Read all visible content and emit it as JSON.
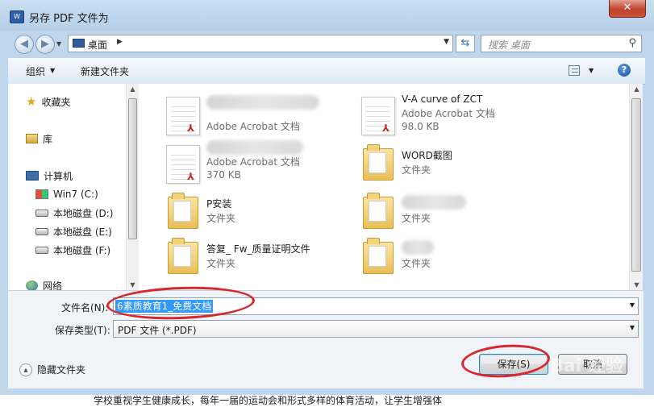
{
  "window": {
    "title": "另存 PDF 文件为",
    "app_icon": "W",
    "close": "✕"
  },
  "address": {
    "location": "桌面",
    "search_placeholder": "搜索 桌面"
  },
  "toolbar": {
    "organize": "组织",
    "new_folder": "新建文件夹"
  },
  "nav": {
    "favorites": "收藏夹",
    "libraries": "库",
    "computer": "计算机",
    "drives": [
      "Win7 (C:)",
      "本地磁盘 (D:)",
      "本地磁盘 (E:)",
      "本地磁盘 (F:)"
    ],
    "network": "网络"
  },
  "files": [
    {
      "name": "",
      "type": "Adobe Acrobat 文档",
      "size": "",
      "kind": "pdf"
    },
    {
      "name": "V-A curve of ZCT",
      "type": "Adobe Acrobat 文档",
      "size": "98.0 KB",
      "kind": "pdf"
    },
    {
      "name": "",
      "type": "Adobe Acrobat 文档",
      "size": "370 KB",
      "kind": "pdf"
    },
    {
      "name": "WORD截图",
      "type": "文件夹",
      "size": "",
      "kind": "folder"
    },
    {
      "name": "P安装",
      "type": "文件夹",
      "size": "",
      "kind": "folder"
    },
    {
      "name": "",
      "type": "文件夹",
      "size": "",
      "kind": "folder"
    },
    {
      "name": "答复_ Fw_质量证明文件",
      "type": "文件夹",
      "size": "",
      "kind": "folder"
    },
    {
      "name": "",
      "type": "文件夹",
      "size": "",
      "kind": "folder"
    }
  ],
  "form": {
    "filename_label": "文件名(N):",
    "filename_value": "6素质教育1_免费文档",
    "type_label": "保存类型(T):",
    "type_value": "PDF 文件 (*.PDF)"
  },
  "footer": {
    "hide_folders": "隐藏文件夹",
    "save": "保存(S)",
    "cancel": "取消"
  },
  "watermark": "Bai 经验",
  "caption": "学校重视学生健康成长，每年一届的运动会和形式多样的体育活动，让学生增强体",
  "colors": {
    "selection": "#3399ff",
    "annotation": "#d8262a",
    "chrome": "#bfd6ec"
  }
}
